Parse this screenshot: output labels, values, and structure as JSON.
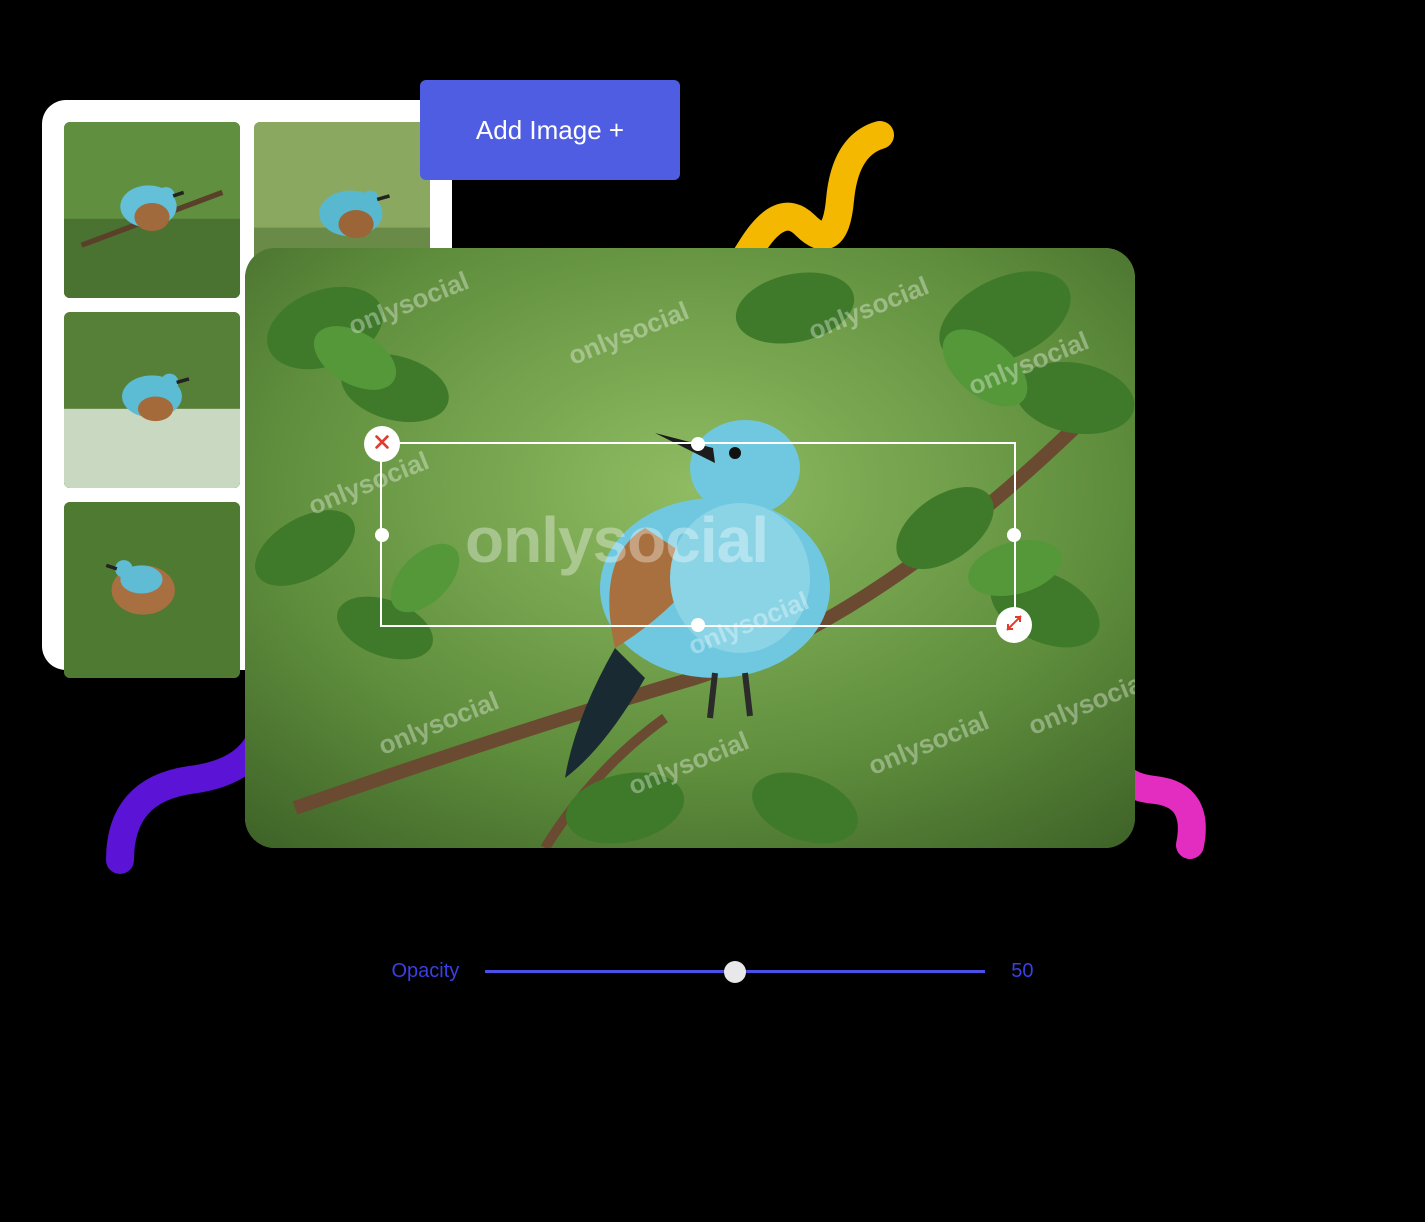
{
  "toolbar": {
    "add_image_label": "Add Image +"
  },
  "watermark": {
    "text": "onlysocial"
  },
  "slider": {
    "label": "Opacity",
    "value": "50",
    "percent": 50
  },
  "colors": {
    "accent": "#4f5de3",
    "close_icon": "#e23b2e",
    "resize_icon": "#e23b2e"
  },
  "thumbnails": {
    "count": 6
  }
}
